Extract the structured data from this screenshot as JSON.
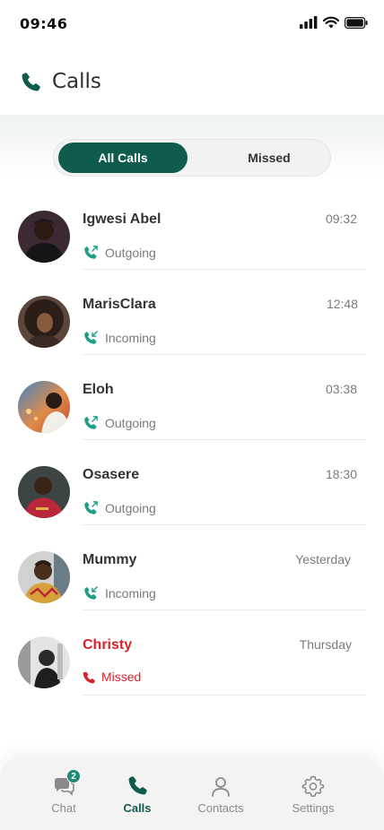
{
  "status_bar": {
    "time": "09:46"
  },
  "header": {
    "title": "Calls",
    "icon": "phone-icon"
  },
  "tabs": {
    "all_calls": "All Calls",
    "missed": "Missed",
    "active": "All Calls"
  },
  "calls": [
    {
      "name": "Igwesi Abel",
      "time": "09:32",
      "type": "Outgoing"
    },
    {
      "name": "MarisClara",
      "time": "12:48",
      "type": "Incoming"
    },
    {
      "name": "Eloh",
      "time": "03:38",
      "type": "Outgoing"
    },
    {
      "name": "Osasere",
      "time": "18:30",
      "type": "Outgoing"
    },
    {
      "name": "Mummy",
      "time": "Yesterday",
      "type": "Incoming"
    },
    {
      "name": "Christy",
      "time": "Thursday",
      "type": "Missed"
    }
  ],
  "nav": {
    "chat": {
      "label": "Chat",
      "badge": "2"
    },
    "calls": {
      "label": "Calls"
    },
    "contacts": {
      "label": "Contacts"
    },
    "settings": {
      "label": "Settings"
    }
  },
  "colors": {
    "accent": "#0f5c4f",
    "accent_light": "#1f9e86",
    "missed": "#d9232b"
  }
}
